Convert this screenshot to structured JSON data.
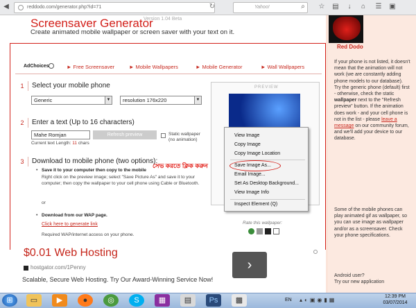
{
  "browser": {
    "url": "reddodo.com/generator.php?id=71",
    "search_placeholder": "Yahoo!",
    "back_icon": "back-arrow-icon",
    "toolbar_icons": [
      "star-icon",
      "reading-list-icon",
      "download-icon",
      "home-icon",
      "menu-icon"
    ]
  },
  "page": {
    "title": "Screensaver Generator",
    "version": "Version 1.04 Beta",
    "subtitle": "Create animated mobile wallpaper or screen saver with your text on it.",
    "adchoices": "AdChoices",
    "nav": [
      "► Free Screensaver",
      "► Mobile Wallpapers",
      "► Mobile Generator",
      "► Wall Wallpapers"
    ],
    "step1": {
      "num": "1",
      "title": "Select your mobile phone",
      "phone": "Generic",
      "resolution": "resolution 176x220"
    },
    "step2": {
      "num": "2",
      "title": "Enter a text (Up to 16 characters)",
      "text_value": "Mahe Romjan",
      "refresh": "Refresh preview",
      "static_label": "Static wallpaper",
      "static_sub": "(no animation)",
      "length_label": "Current text Length:",
      "length_value": "11",
      "length_unit": "chars"
    },
    "step3": {
      "num": "3",
      "title": "Download to mobile phone (two options):",
      "opt1_bold": "Save it to your computer then copy to the mobile",
      "opt1_text": "Right click on the preview image; select \"Save Picture As\" and save it to your computer; then copy the wallpaper to your cell phone using Cable or Bluetooth.",
      "or": "or",
      "opt2_bold": "Download from our WAP page.",
      "opt2_link": "Click here to generate link",
      "required": "Required WAP/internet access on your phone."
    },
    "preview_label": "PREVIEW",
    "rate_label": "Rate this wallpaper:",
    "bengali_note": "সেভ করতে ক্লিক করুন"
  },
  "context_menu": {
    "items": [
      "View Image",
      "Copy Image",
      "Copy Image Location",
      "Save Image As...",
      "Email Image...",
      "Set As Desktop Background...",
      "View Image Info",
      "Inspect Element (Q)"
    ]
  },
  "ad": {
    "title": "$0.01 Web Hosting",
    "url": "hostgator.com/1Penny",
    "text": "Scalable, Secure Web Hosting. Try Our Award-Winning Service Now!",
    "arrow": "›"
  },
  "sidebar": {
    "logo": "Red Dodo",
    "p1": "If your phone is not listed, it doesn't mean that the animation will not work (we are constantly adding phone models to our database). Try the generic phone (default) first - otherwise, check the static",
    "p1_bold": "wallpaper",
    "p1b": "next to the \"Refresh preview\" button. If the animation does work - and your cell phone is not in the list - please",
    "p1_link": "leave a message",
    "p1c": "on our community forum, and we'll add your device to our database.",
    "p2": "Some of the mobile phones can play animated gif as wallpaper, so you can use image as wallpaper and/or as a screensaver. Check your phone specifications.",
    "p3": "Android user?",
    "p4": "Try our new application"
  },
  "taskbar": {
    "lang": "EN",
    "time": "12:39 PM",
    "date": "03/07/2014",
    "apps": [
      "start-orb-icon",
      "explorer-icon",
      "media-player-icon",
      "firefox-icon",
      "chrome-icon",
      "skype-icon",
      "winrar-icon",
      "notepad-icon",
      "photoshop-icon",
      "calc-icon"
    ]
  }
}
